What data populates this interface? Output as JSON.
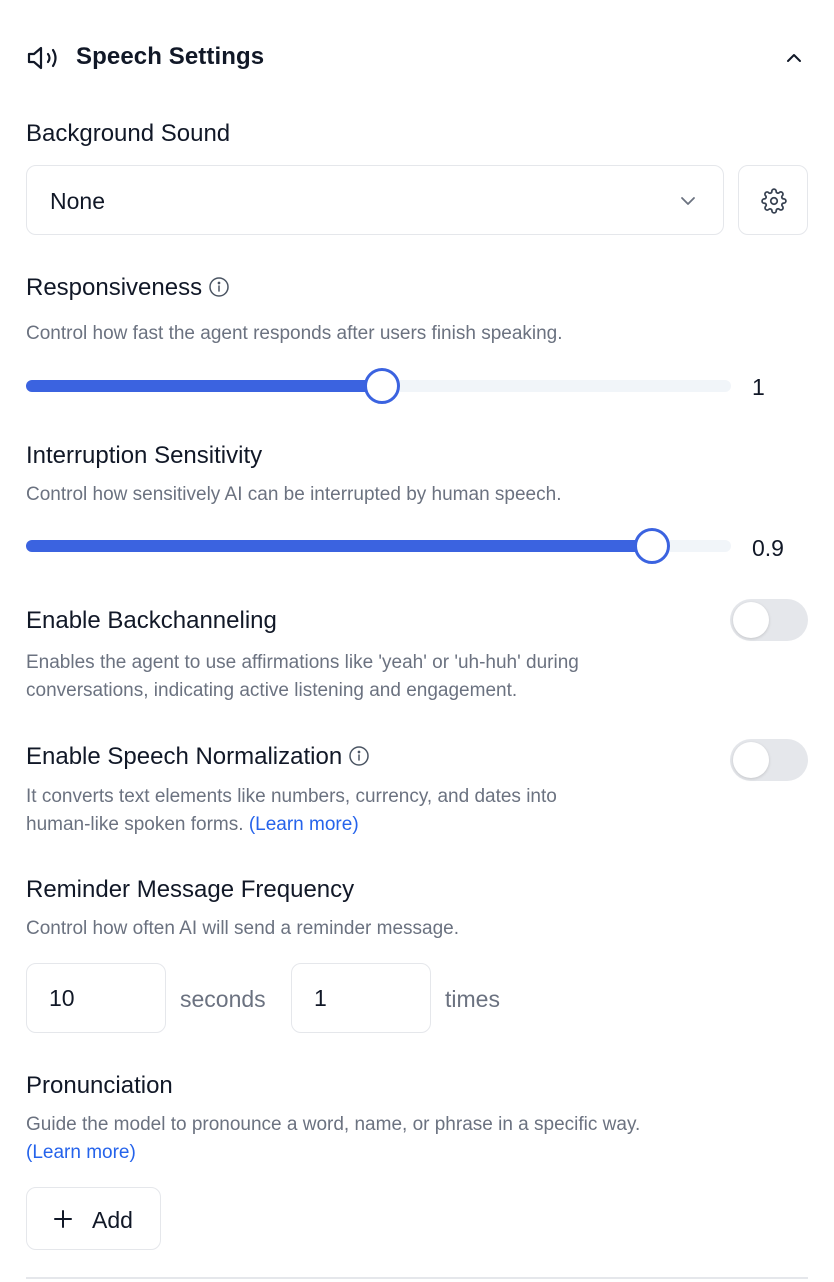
{
  "header": {
    "title": "Speech Settings",
    "icon": "speaker-icon"
  },
  "background_sound": {
    "label": "Background Sound",
    "selected": "None"
  },
  "responsiveness": {
    "label": "Responsiveness",
    "description": "Control how fast the agent responds after users finish speaking.",
    "value_text": "1",
    "fraction": 0.5
  },
  "interruption": {
    "label": "Interruption Sensitivity",
    "description": "Control how sensitively AI can be interrupted by human speech.",
    "value_text": "0.9",
    "fraction": 0.9
  },
  "backchanneling": {
    "label": "Enable Backchanneling",
    "description_line1": "Enables the agent to use affirmations like 'yeah' or 'uh-huh' during",
    "description_line2": "conversations, indicating active listening and engagement.",
    "enabled": false
  },
  "normalization": {
    "label": "Enable Speech Normalization",
    "description_line1": "It converts text elements like numbers, currency, and dates into",
    "description_line2": "human-like spoken forms.",
    "learn_more": "(Learn more)",
    "enabled": false
  },
  "reminder": {
    "label": "Reminder Message Frequency",
    "description": "Control how often AI will send a reminder message.",
    "seconds_value": "10",
    "seconds_label": "seconds",
    "times_value": "1",
    "times_label": "times"
  },
  "pronunciation": {
    "label": "Pronunciation",
    "description": "Guide the model to pronounce a word, name, or phrase in a specific way.",
    "learn_more": "(Learn more)",
    "add_label": "Add"
  },
  "colors": {
    "accent": "#3b63e0",
    "link": "#2563eb",
    "muted_text": "#6b7280",
    "border": "#e5e7eb"
  }
}
